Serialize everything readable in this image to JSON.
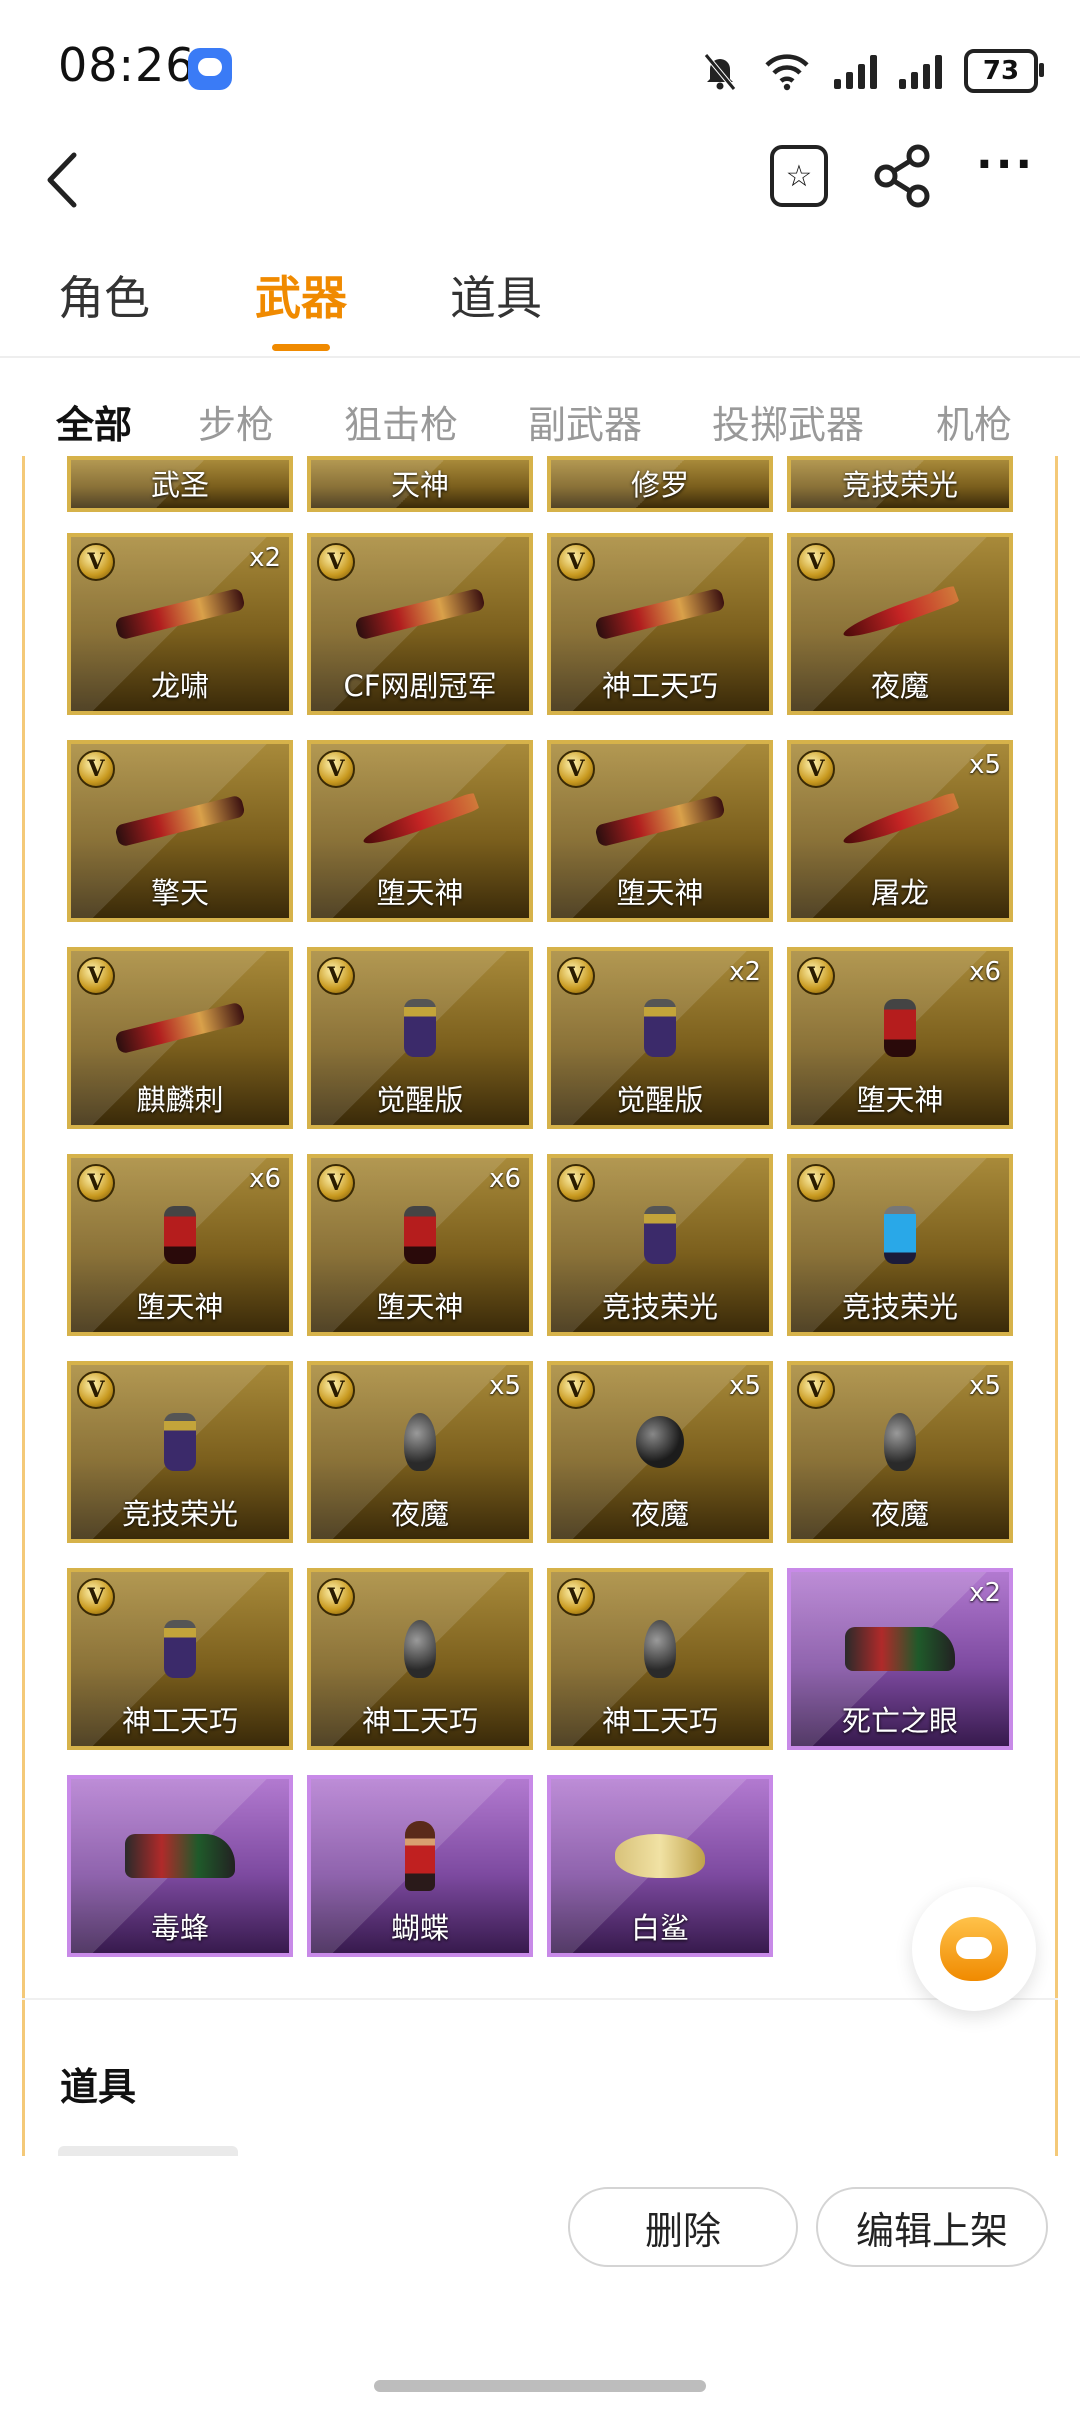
{
  "status_bar": {
    "time": "08:26",
    "battery": "73"
  },
  "header": {
    "fav_icon": "star-box-icon",
    "share_icon": "share-icon",
    "more_icon": "more-dots-icon",
    "more_text": "···"
  },
  "primary_tabs": {
    "role": "角色",
    "weapon": "武器",
    "item": "道具",
    "active": "武器"
  },
  "secondary_tabs": {
    "all": "全部",
    "rifle": "步枪",
    "sniper": "狙击枪",
    "sidearm": "副武器",
    "throw": "投掷武器",
    "mg": "机枪",
    "active": "全部"
  },
  "colors": {
    "accent": "#f08a00",
    "gold_tile": "#8c6d27",
    "purple_tile": "#8a55ad"
  },
  "partial_row": [
    {
      "label": "武圣"
    },
    {
      "label": "天神"
    },
    {
      "label": "修罗"
    },
    {
      "label": "竞技荣光"
    }
  ],
  "weapons": [
    {
      "label": "龙啸",
      "count": "x2",
      "rarity": "gold",
      "vip": true,
      "art": "long"
    },
    {
      "label": "CF网剧冠军",
      "count": "",
      "rarity": "gold",
      "vip": true,
      "art": "long"
    },
    {
      "label": "神工天巧",
      "count": "",
      "rarity": "gold",
      "vip": true,
      "art": "long"
    },
    {
      "label": "夜魔",
      "count": "",
      "rarity": "gold",
      "vip": true,
      "art": "knife"
    },
    {
      "label": "擎天",
      "count": "",
      "rarity": "gold",
      "vip": true,
      "art": "long"
    },
    {
      "label": "堕天神",
      "count": "",
      "rarity": "gold",
      "vip": true,
      "art": "knife"
    },
    {
      "label": "堕天神",
      "count": "",
      "rarity": "gold",
      "vip": true,
      "art": "long"
    },
    {
      "label": "屠龙",
      "count": "x5",
      "rarity": "gold",
      "vip": true,
      "art": "knife"
    },
    {
      "label": "麒麟刺",
      "count": "",
      "rarity": "gold",
      "vip": true,
      "art": "long"
    },
    {
      "label": "觉醒版",
      "count": "",
      "rarity": "gold",
      "vip": true,
      "art": "gren"
    },
    {
      "label": "觉醒版",
      "count": "x2",
      "rarity": "gold",
      "vip": true,
      "art": "gren"
    },
    {
      "label": "堕天神",
      "count": "x6",
      "rarity": "gold",
      "vip": true,
      "art": "gren-red"
    },
    {
      "label": "堕天神",
      "count": "x6",
      "rarity": "gold",
      "vip": true,
      "art": "gren-red"
    },
    {
      "label": "堕天神",
      "count": "x6",
      "rarity": "gold",
      "vip": true,
      "art": "gren-red"
    },
    {
      "label": "竞技荣光",
      "count": "",
      "rarity": "gold",
      "vip": true,
      "art": "gren"
    },
    {
      "label": "竞技荣光",
      "count": "",
      "rarity": "gold",
      "vip": true,
      "art": "gren-blue"
    },
    {
      "label": "竞技荣光",
      "count": "",
      "rarity": "gold",
      "vip": true,
      "art": "gren"
    },
    {
      "label": "夜魔",
      "count": "x5",
      "rarity": "gold",
      "vip": true,
      "art": "gren-dark"
    },
    {
      "label": "夜魔",
      "count": "x5",
      "rarity": "gold",
      "vip": true,
      "art": "gren-ball"
    },
    {
      "label": "夜魔",
      "count": "x5",
      "rarity": "gold",
      "vip": true,
      "art": "gren-dark"
    },
    {
      "label": "神工天巧",
      "count": "",
      "rarity": "gold",
      "vip": true,
      "art": "gren"
    },
    {
      "label": "神工天巧",
      "count": "",
      "rarity": "gold",
      "vip": true,
      "art": "gren-dark"
    },
    {
      "label": "神工天巧",
      "count": "",
      "rarity": "gold",
      "vip": true,
      "art": "gren-dark"
    },
    {
      "label": "死亡之眼",
      "count": "x2",
      "rarity": "purple",
      "vip": false,
      "art": "smg"
    },
    {
      "label": "毒蜂",
      "count": "",
      "rarity": "purple",
      "vip": false,
      "art": "smg"
    },
    {
      "label": "蝴蝶",
      "count": "",
      "rarity": "purple",
      "vip": false,
      "art": "fig"
    },
    {
      "label": "白鲨",
      "count": "",
      "rarity": "purple",
      "vip": false,
      "art": "shark"
    }
  ],
  "section": {
    "title": "道具"
  },
  "actions": {
    "delete": "删除",
    "edit": "编辑上架"
  },
  "vip_badge": "V"
}
